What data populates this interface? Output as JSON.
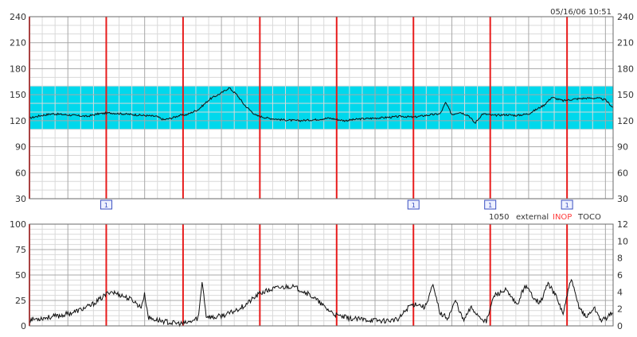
{
  "header": {
    "timestamp": "05/16/06 10:51"
  },
  "status_line": {
    "code": "1050",
    "mode": "external",
    "inop_label": "INOP",
    "channel": "TOCO"
  },
  "colors": {
    "normal_band": "#00d8ec",
    "divider": "#e81c1c",
    "grid_major": "#a8a8a8",
    "grid_minor": "#d9d9d9",
    "trace": "#111111",
    "inop": "#ff3a3a",
    "marker": "#3a4fc0"
  },
  "markers": {
    "label": "1",
    "positions": [
      1,
      5,
      6,
      7
    ]
  },
  "chart_data": [
    {
      "type": "line",
      "title": "",
      "xlabel": "",
      "ylabel": "",
      "ylim": [
        30,
        240
      ],
      "y_ticks_left": [
        "240",
        "210",
        "180",
        "150",
        "120",
        "90",
        "60",
        "30"
      ],
      "y_ticks_right": [
        "240",
        "210",
        "180",
        "150",
        "120",
        "90",
        "60",
        "30"
      ],
      "x_range": [
        0,
        7.6
      ],
      "divisions": 8,
      "grid": true,
      "normal_band": [
        110,
        160
      ],
      "series": [
        {
          "x": [
            0,
            0.15,
            0.3,
            0.45,
            0.6,
            0.75,
            0.9,
            1.05,
            1.2,
            1.35,
            1.5,
            1.65,
            1.75,
            1.85,
            1.95,
            2.05,
            2.2,
            2.35,
            2.5,
            2.6,
            2.7,
            2.8,
            2.95,
            3.1,
            3.3,
            3.5,
            3.7,
            3.9,
            4.1,
            4.3,
            4.5,
            4.7,
            4.85,
            5.0,
            5.15,
            5.25,
            5.35,
            5.42,
            5.5,
            5.6,
            5.72,
            5.8,
            5.9,
            6.05,
            6.2,
            6.35,
            6.5,
            6.6,
            6.7,
            6.8,
            6.95,
            7.1,
            7.25,
            7.4,
            7.5,
            7.6
          ],
          "values": [
            123,
            126,
            128,
            127,
            126,
            125,
            128,
            129,
            128,
            127,
            126,
            125,
            121,
            123,
            126,
            127,
            133,
            145,
            152,
            158,
            150,
            138,
            126,
            123,
            121,
            120,
            121,
            123,
            120,
            122,
            123,
            124,
            125,
            124,
            126,
            127,
            128,
            141,
            127,
            130,
            126,
            117,
            128,
            126,
            127,
            126,
            128,
            133,
            138,
            147,
            143,
            145,
            146,
            146,
            144,
            135
          ]
        }
      ]
    },
    {
      "type": "line",
      "title": "",
      "xlabel": "",
      "ylabel": "",
      "ylim": [
        0,
        100
      ],
      "y_ticks_left": [
        "100",
        "75",
        "50",
        "25",
        "0"
      ],
      "y2lim": [
        0,
        13.33
      ],
      "y_ticks_right": [
        "12",
        "10",
        "8",
        "6",
        "4",
        "2",
        "0"
      ],
      "x_range": [
        0,
        7.6
      ],
      "divisions": 8,
      "grid": true,
      "series": [
        {
          "x": [
            0,
            0.2,
            0.4,
            0.6,
            0.8,
            0.95,
            1.05,
            1.2,
            1.35,
            1.45,
            1.5,
            1.55,
            1.65,
            1.85,
            2.0,
            2.1,
            2.2,
            2.25,
            2.3,
            2.4,
            2.6,
            2.8,
            3.0,
            3.2,
            3.4,
            3.55,
            3.7,
            3.85,
            4.0,
            4.2,
            4.4,
            4.6,
            4.8,
            4.95,
            5.05,
            5.15,
            5.25,
            5.35,
            5.45,
            5.55,
            5.65,
            5.75,
            5.85,
            5.95,
            6.05,
            6.2,
            6.35,
            6.45,
            6.55,
            6.65,
            6.75,
            6.85,
            6.95,
            7.05,
            7.15,
            7.25,
            7.35,
            7.45,
            7.55,
            7.6
          ],
          "values": [
            6,
            8,
            10,
            14,
            20,
            28,
            34,
            30,
            25,
            18,
            31,
            8,
            6,
            3,
            2,
            4,
            8,
            45,
            10,
            8,
            12,
            20,
            32,
            37,
            39,
            35,
            28,
            18,
            10,
            7,
            6,
            5,
            6,
            20,
            22,
            18,
            40,
            12,
            8,
            25,
            5,
            18,
            10,
            4,
            30,
            35,
            20,
            40,
            30,
            22,
            42,
            30,
            12,
            46,
            20,
            8,
            18,
            5,
            10,
            15
          ]
        }
      ]
    }
  ]
}
